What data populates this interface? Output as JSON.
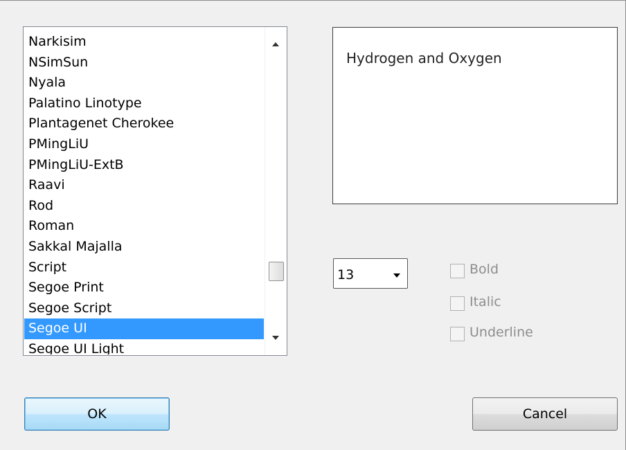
{
  "font_list": {
    "items": [
      "Narkisim",
      "NSimSun",
      "Nyala",
      "Palatino Linotype",
      "Plantagenet Cherokee",
      "PMingLiU",
      "PMingLiU-ExtB",
      "Raavi",
      "Rod",
      "Roman",
      "Sakkal Majalla",
      "Script",
      "Segoe Print",
      "Segoe Script",
      "Segoe UI",
      "Segoe UI Light"
    ],
    "selected": "Segoe UI"
  },
  "preview": {
    "text": "Hydrogen and Oxygen"
  },
  "size": {
    "value": "13"
  },
  "styles": {
    "bold_label": "Bold",
    "italic_label": "Italic",
    "underline_label": "Underline",
    "bold_checked": false,
    "italic_checked": false,
    "underline_checked": false
  },
  "buttons": {
    "ok_label": "OK",
    "cancel_label": "Cancel"
  }
}
